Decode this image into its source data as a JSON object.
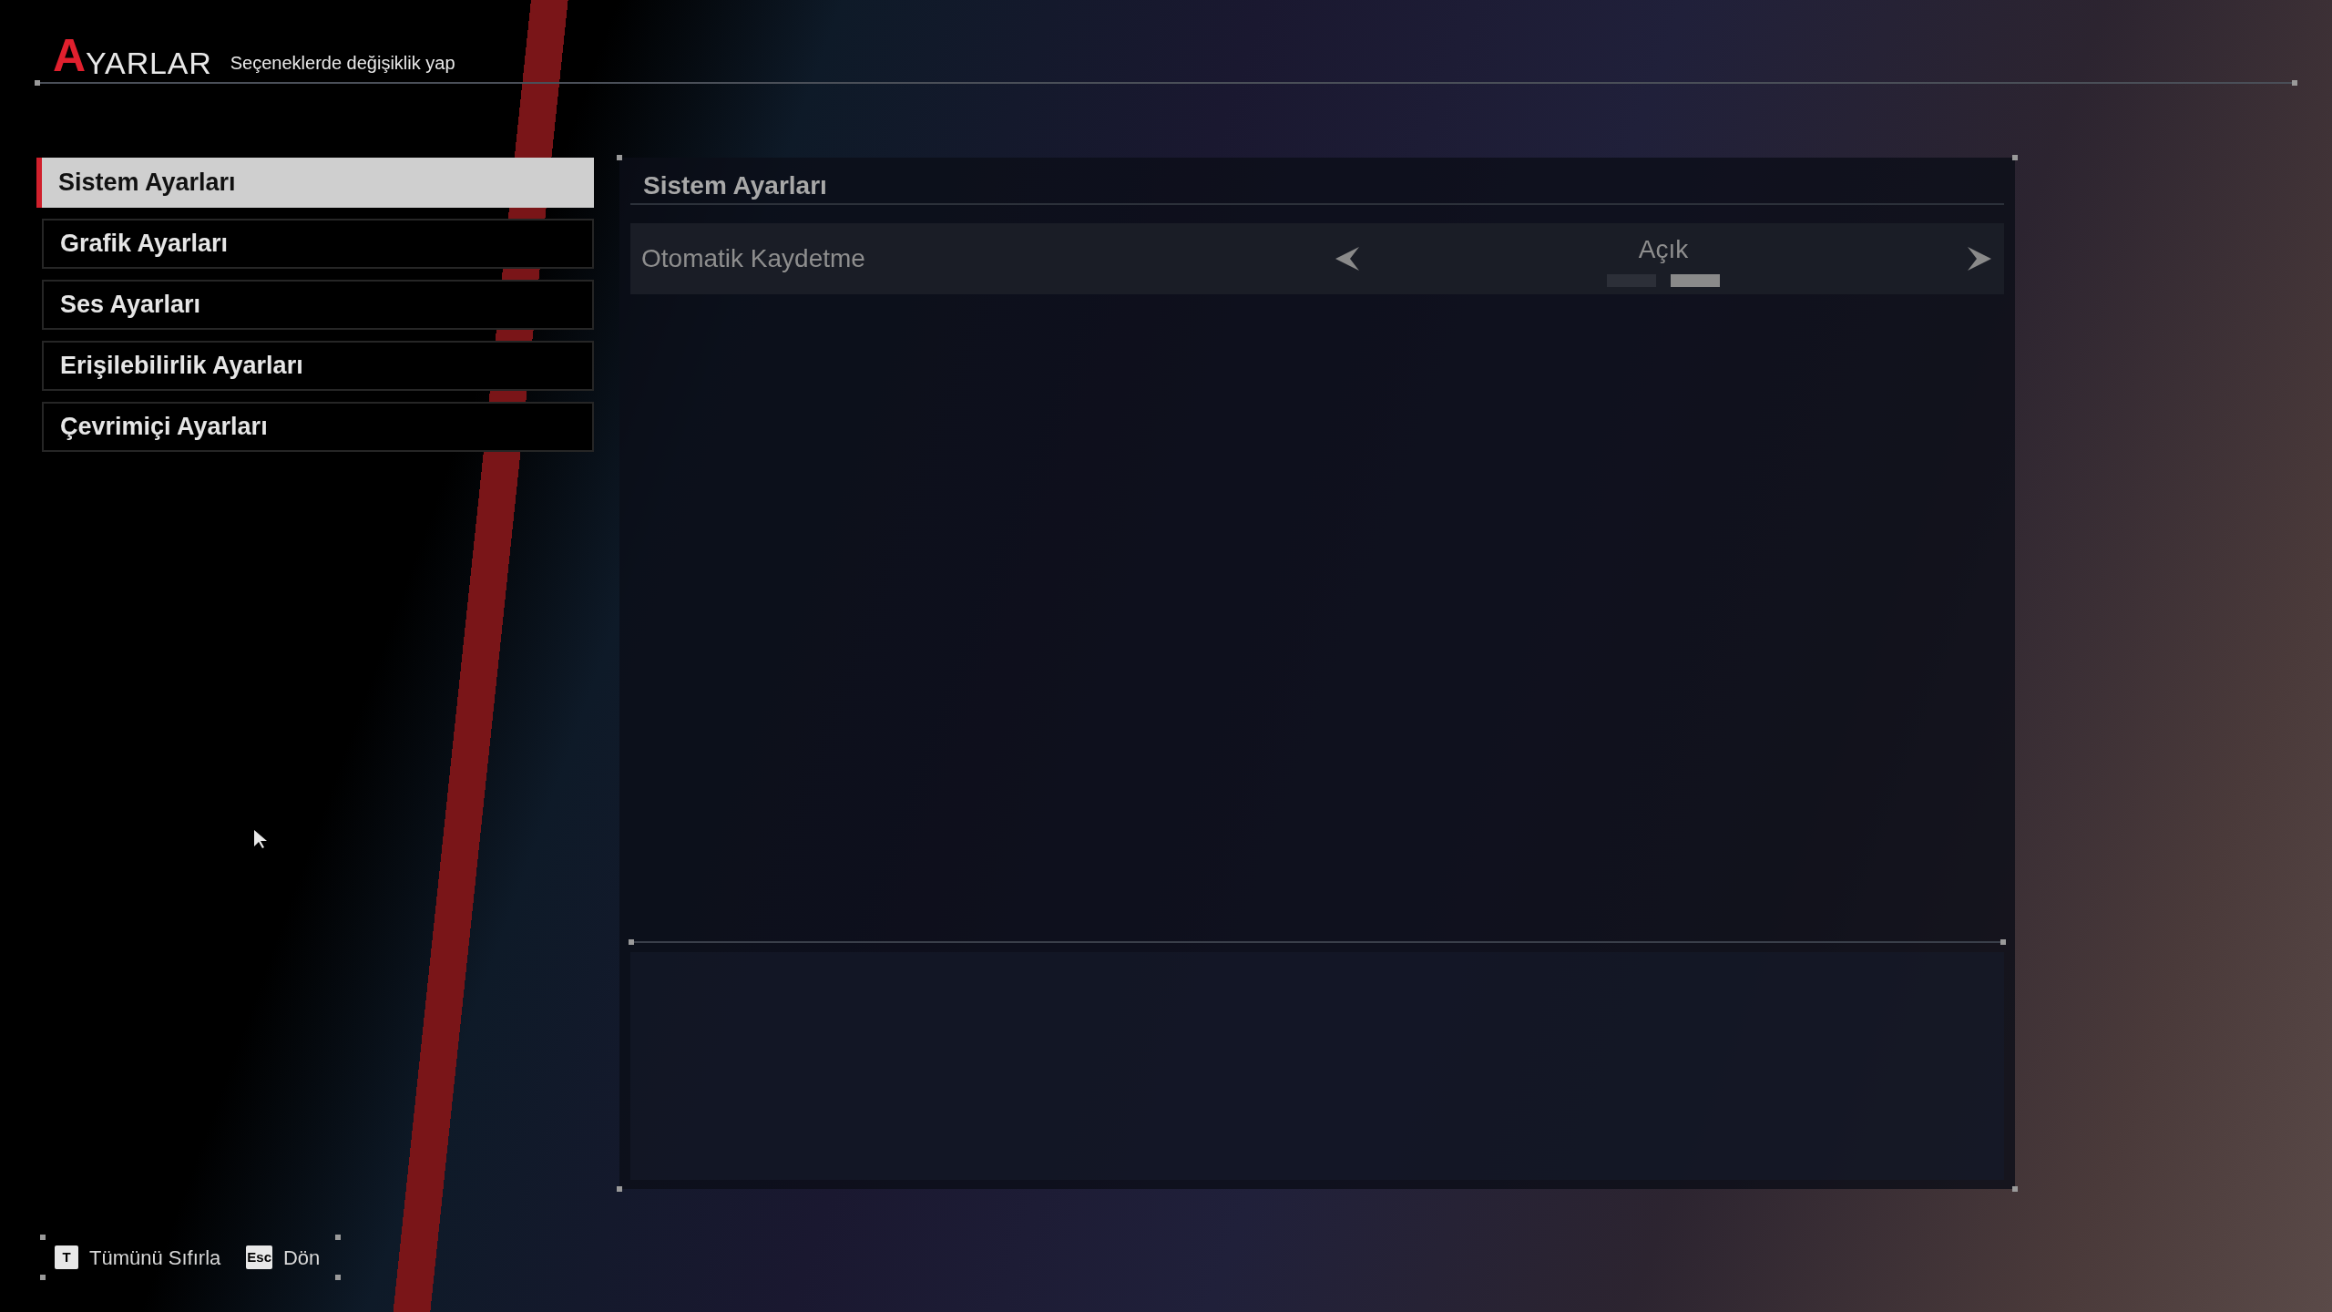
{
  "header": {
    "title_initial": "A",
    "title_rest": "YARLAR",
    "subtitle": "Seçeneklerde değişiklik yap"
  },
  "sidebar": {
    "items": [
      {
        "label": "Sistem Ayarları",
        "selected": true
      },
      {
        "label": "Grafik Ayarları",
        "selected": false
      },
      {
        "label": "Ses Ayarları",
        "selected": false
      },
      {
        "label": "Erişilebilirlik Ayarları",
        "selected": false
      },
      {
        "label": "Çevrimiçi Ayarları",
        "selected": false
      }
    ]
  },
  "panel": {
    "title": "Sistem Ayarları",
    "settings": [
      {
        "label": "Otomatik Kaydetme",
        "value": "Açık",
        "segments": [
          {
            "selected": false
          },
          {
            "selected": true
          }
        ]
      }
    ]
  },
  "footer": {
    "hints": [
      {
        "key": "T",
        "label": "Tümünü Sıfırla"
      },
      {
        "key": "Esc",
        "label": "Dön"
      }
    ]
  }
}
